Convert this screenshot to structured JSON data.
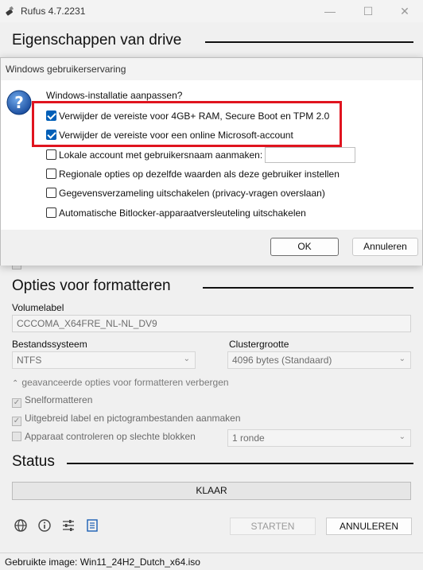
{
  "window": {
    "title": "Rufus 4.7.2231",
    "minimize": "—",
    "maximize": "☐",
    "close": "✕"
  },
  "sections": {
    "drive": "Eigenschappen van drive",
    "format": "Opties voor formatteren",
    "status": "Status"
  },
  "format": {
    "volume_label_title": "Volumelabel",
    "volume_label_value": "CCCOMA_X64FRE_NL-NL_DV9",
    "filesystem_title": "Bestandssysteem",
    "filesystem_value": "NTFS",
    "cluster_title": "Clustergrootte",
    "cluster_value": "4096 bytes (Standaard)",
    "advanced_toggle": "geavanceerde opties voor formatteren verbergen",
    "quick_format": "Snelformatteren",
    "extended_label": "Uitgebreid label en pictogrambestanden aanmaken",
    "bad_blocks": "Apparaat controleren op slechte blokken",
    "passes_value": "1 ronde"
  },
  "status": {
    "progress_text": "KLAAR",
    "start_label": "STARTEN",
    "cancel_label": "ANNULEREN",
    "statusbar_text": "Gebruikte image: Win11_24H2_Dutch_x64.iso"
  },
  "dialog": {
    "title": "Windows gebruikerservaring",
    "prompt": "Windows-installatie aanpassen?",
    "options": [
      {
        "label": "Verwijder de vereiste voor 4GB+ RAM, Secure Boot en TPM 2.0",
        "checked": true
      },
      {
        "label": "Verwijder de vereiste voor een online Microsoft-account",
        "checked": true
      },
      {
        "label": "Lokale account met gebruikersnaam aanmaken:",
        "checked": false
      },
      {
        "label": "Regionale opties op dezelfde waarden als deze gebruiker instellen",
        "checked": false
      },
      {
        "label": "Gegevensverzameling uitschakelen (privacy-vragen overslaan)",
        "checked": false
      },
      {
        "label": "Automatische Bitlocker-apparaatversleuteling uitschakelen",
        "checked": false
      }
    ],
    "ok_label": "OK",
    "cancel_label": "Annuleren"
  },
  "colors": {
    "highlight": "#e0141f",
    "checkbox_accent": "#005fb8"
  }
}
